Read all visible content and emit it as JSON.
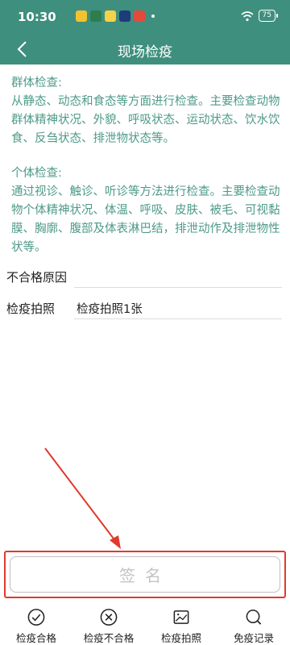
{
  "status_bar": {
    "time": "10:30",
    "battery": "75"
  },
  "header": {
    "title": "现场检疫"
  },
  "content": {
    "group_heading": "群体检查:",
    "group_text": "从静态、动态和食态等方面进行检查。主要检查动物群体精神状况、外貌、呼吸状态、运动状态、饮水饮食、反刍状态、排泄物状态等。",
    "individual_heading": "个体检查:",
    "individual_text": "通过视诊、触诊、听诊等方法进行检查。主要检查动物个体精神状况、体温、呼吸、皮肤、被毛、可视黏膜、胸廓、腹部及体表淋巴结，排泄动作及排泄物性状等。"
  },
  "form": {
    "reject_reason_label": "不合格原因",
    "reject_reason_value": "",
    "photo_label": "检疫拍照",
    "photo_value": "检疫拍照1张"
  },
  "sign_button": {
    "label": "签名"
  },
  "bottom_nav": {
    "items": [
      {
        "label": "检疫合格",
        "icon": "check-circle-icon"
      },
      {
        "label": "检疫不合格",
        "icon": "x-circle-icon"
      },
      {
        "label": "检疫拍照",
        "icon": "image-icon"
      },
      {
        "label": "免疫记录",
        "icon": "search-icon"
      }
    ]
  },
  "colors": {
    "header_bg": "#3f8f7e",
    "info_text": "#4e9a89",
    "annotation_red": "#e03a2e"
  }
}
